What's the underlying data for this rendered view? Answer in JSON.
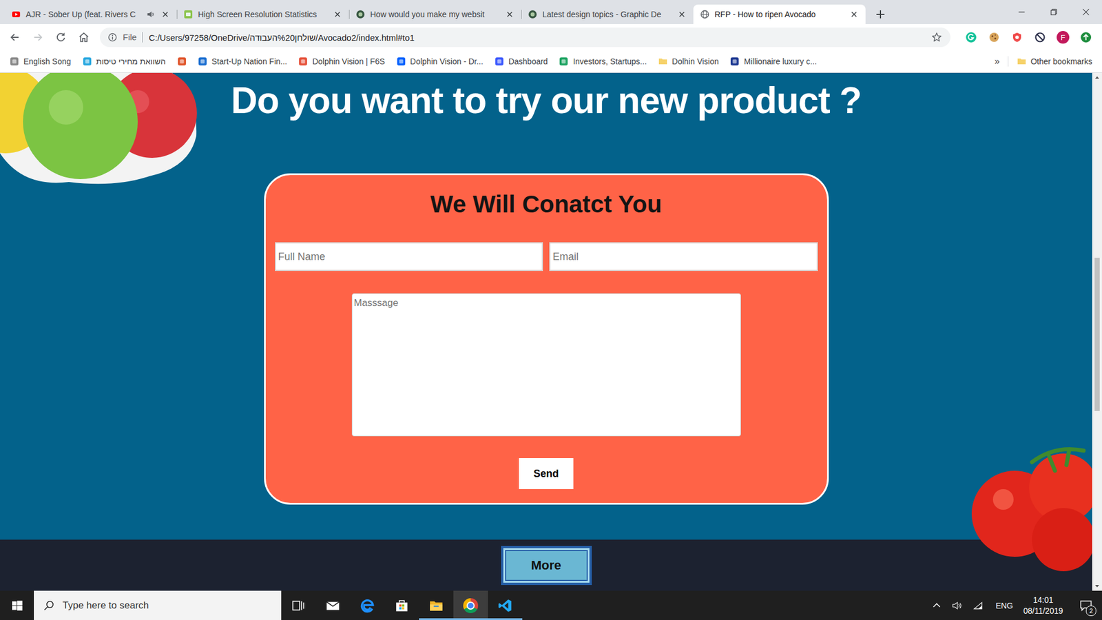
{
  "browser": {
    "tabs": [
      {
        "label": "AJR - Sober Up (feat. Rivers C",
        "kind": "youtube",
        "audio": true,
        "selected": false
      },
      {
        "label": "High Screen Resolution Statistics",
        "kind": "w3",
        "audio": false,
        "selected": false
      },
      {
        "label": "How would you make my websit",
        "kind": "discourse",
        "audio": false,
        "selected": false
      },
      {
        "label": "Latest design topics - Graphic De",
        "kind": "discourse",
        "audio": false,
        "selected": false
      },
      {
        "label": "RFP - How to ripen Avocado",
        "kind": "globe",
        "audio": false,
        "selected": true
      }
    ],
    "navigation": {
      "back_enabled": true,
      "forward_enabled": false
    },
    "address": {
      "scheme": "File",
      "url": "C:/Users/97258/OneDrive/שולחן%20העבודה/Avocado2/index.html#to1",
      "bookmarked": false
    },
    "profile_initial": "F",
    "bookmarks": [
      {
        "label": "English Song",
        "kind": "page",
        "color": "#8a8a8a"
      },
      {
        "label": "השוואת מחירי טיסות",
        "kind": "page",
        "color": "#29a8e0"
      },
      {
        "kind": "page",
        "color": "#e0562c"
      },
      {
        "label": "Start-Up Nation Fin...",
        "kind": "page",
        "color": "#1c6fd1"
      },
      {
        "label": "Dolphin Vision | F6S",
        "kind": "page",
        "color": "#e6533c"
      },
      {
        "label": "Dolphin Vision - Dr...",
        "kind": "page",
        "color": "#0061fe"
      },
      {
        "label": "Dashboard",
        "kind": "page",
        "color": "#3d5afe"
      },
      {
        "label": "Investors, Startups...",
        "kind": "page",
        "color": "#1fa463"
      },
      {
        "label": "Dolhin Vision",
        "kind": "folder",
        "color": "#f6d26b"
      },
      {
        "label": "Millionaire luxury c...",
        "kind": "page",
        "color": "#1f3a93"
      }
    ],
    "bookmarks_overflow": "»",
    "other_bookmarks": "Other bookmarks"
  },
  "page": {
    "heading": "Do you want to try our new product ?",
    "form": {
      "title": "We Will Conatct You",
      "fields": [
        {
          "placeholder": "Full Name"
        },
        {
          "placeholder": "Email"
        }
      ],
      "message_placeholder": "Masssage",
      "submit": "Send"
    },
    "footer": {
      "button": "More"
    },
    "scrollbar": {
      "thumb_start": 0.351,
      "thumb_size": 0.308
    }
  },
  "taskbar": {
    "search_placeholder": "Type here to search",
    "apps": [
      {
        "kind": "task-view",
        "running": false,
        "selected": false
      },
      {
        "kind": "mail",
        "running": false,
        "selected": false
      },
      {
        "kind": "edge",
        "running": false,
        "selected": false
      },
      {
        "kind": "store",
        "running": false,
        "selected": false
      },
      {
        "kind": "explorer",
        "running": true,
        "selected": false
      },
      {
        "kind": "chrome",
        "running": true,
        "selected": true
      },
      {
        "kind": "vscode",
        "running": true,
        "selected": false
      }
    ],
    "language": "ENG",
    "time": "14:01",
    "date": "08/11/2019",
    "notifications": "2"
  }
}
